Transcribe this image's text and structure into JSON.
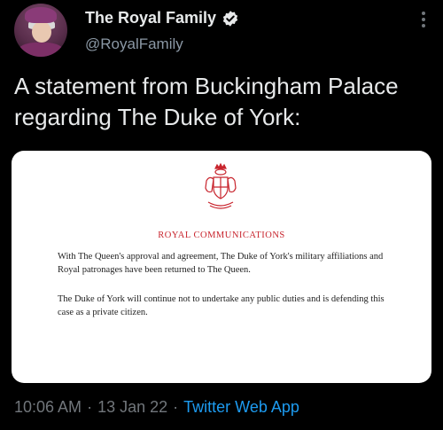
{
  "account": {
    "display_name": "The Royal Family",
    "handle": "@RoyalFamily",
    "verified": true
  },
  "tweet": {
    "text": "A statement from Buckingham Palace regarding The Duke of York:"
  },
  "media": {
    "heading": "ROYAL COMMUNICATIONS",
    "paragraph_1": "With The Queen's approval and agreement, The Duke of York's military affiliations and Royal patronages have been returned to The Queen.",
    "paragraph_2": "The Duke of York will continue not to undertake any public duties and is defending this case as a private citizen."
  },
  "meta": {
    "time": "10:06 AM",
    "separator": "·",
    "date": "13 Jan 22",
    "source": "Twitter Web App"
  },
  "colors": {
    "background": "#000000",
    "accent": "#1d9bf0",
    "crest_red": "#c8242d"
  },
  "icons": [
    "verified-badge-icon",
    "more-options-icon",
    "royal-crest-icon"
  ]
}
